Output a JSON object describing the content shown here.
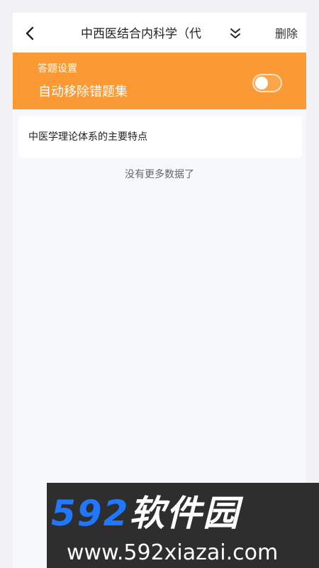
{
  "header": {
    "title": "中西医结合内科学（代",
    "delete_label": "删除"
  },
  "settings": {
    "section_label": "答题设置",
    "option_label": "自动移除错题集",
    "auto_remove_enabled": false
  },
  "questions": [
    {
      "text": "中医学理论体系的主要特点"
    }
  ],
  "list_footer": "没有更多数据了",
  "watermark": {
    "logo_number": "592",
    "logo_text": "软件园",
    "url": "www.592xiazai.com"
  },
  "colors": {
    "accent": "#fb9a34",
    "background": "#f7f8fb"
  },
  "icons": {
    "back": "chevron-left-icon",
    "expand": "double-chevron-down-icon"
  }
}
